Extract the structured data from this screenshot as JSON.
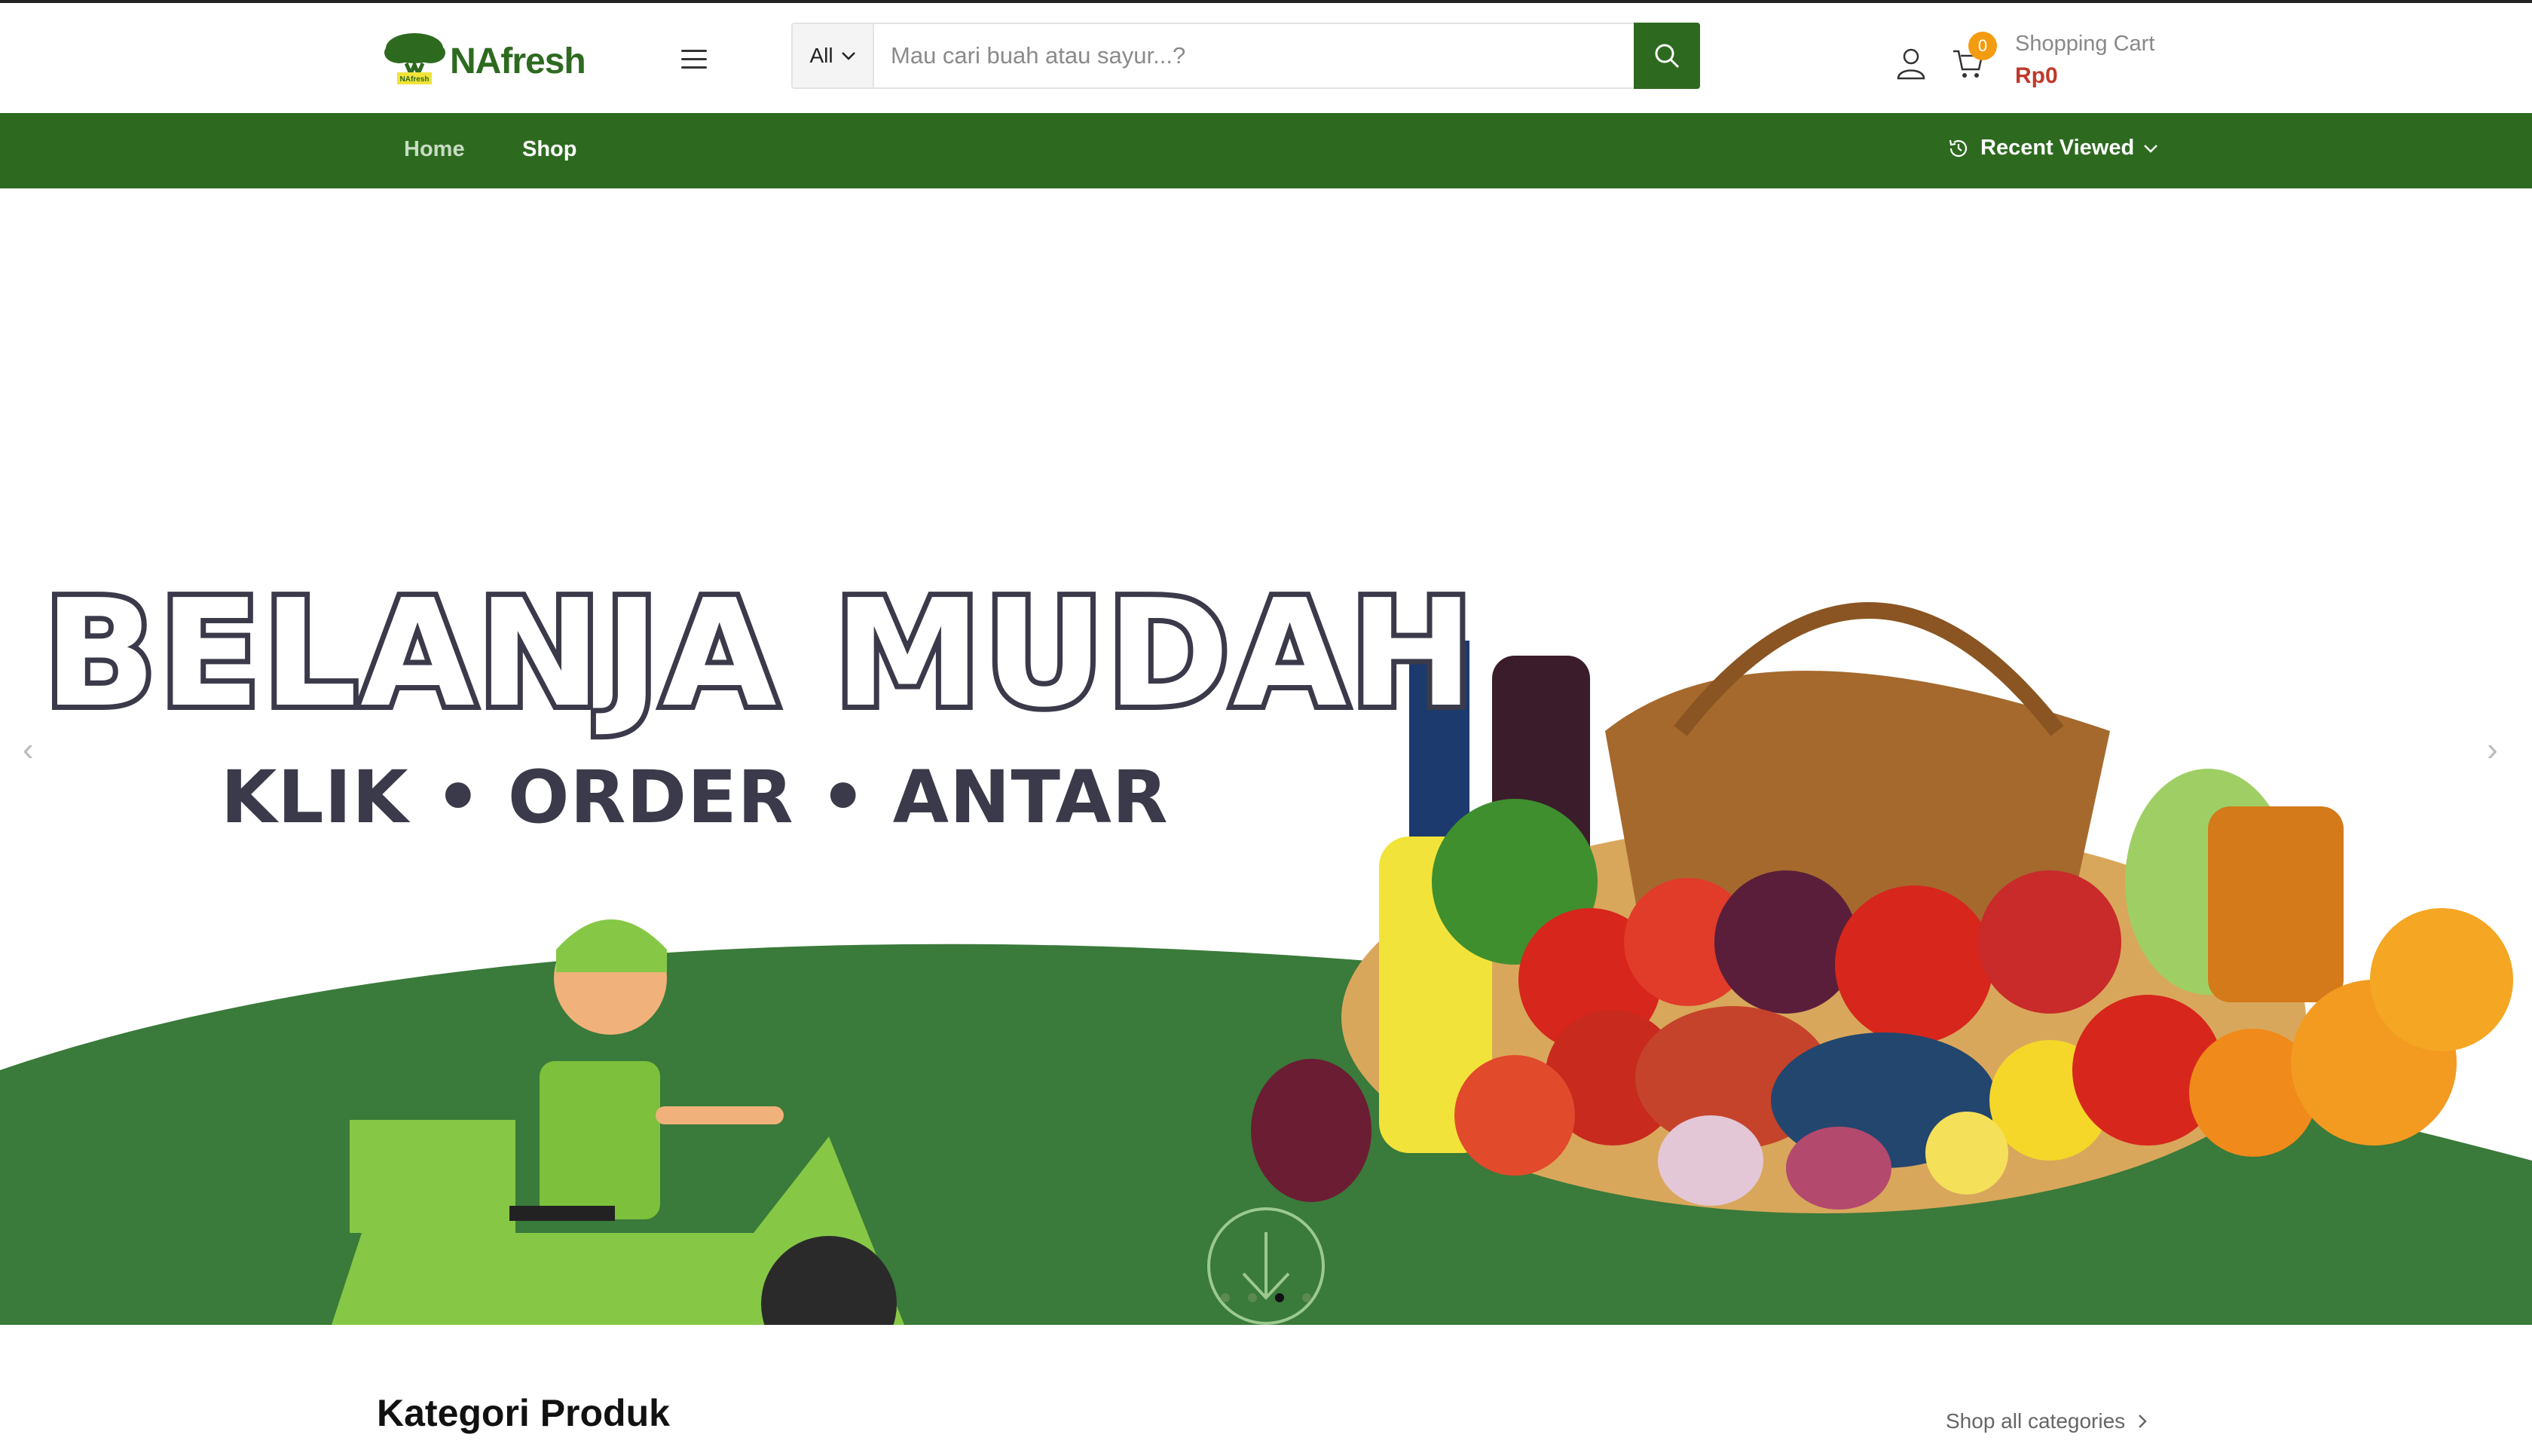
{
  "header": {
    "logo_text": "NAfresh",
    "logo_badge": "NAfresh",
    "search": {
      "category_label": "All",
      "placeholder": "Mau cari buah atau sayur...?",
      "value": ""
    },
    "cart": {
      "count": "0",
      "label": "Shopping Cart",
      "total": "Rp0"
    }
  },
  "nav": {
    "items": [
      {
        "label": "Home"
      },
      {
        "label": "Shop"
      }
    ],
    "recent_viewed_label": "Recent Viewed"
  },
  "hero": {
    "headline": "BELANJA MUDAH",
    "subline": "KLIK • ORDER • ANTAR",
    "slides_total": 4,
    "active_slide": 3
  },
  "categories": {
    "title": "Kategori Produk",
    "shop_all_label": "Shop all categories"
  },
  "colors": {
    "brand_green": "#2d6a1f",
    "hero_green": "#3a7a3a",
    "price_red": "#c0392b",
    "badge_orange": "#f39c12"
  },
  "icons": [
    "hamburger-menu-icon",
    "search-icon",
    "user-icon",
    "cart-icon",
    "history-icon",
    "chevron-down-icon",
    "chevron-left-icon",
    "chevron-right-icon",
    "scroll-down-icon"
  ]
}
